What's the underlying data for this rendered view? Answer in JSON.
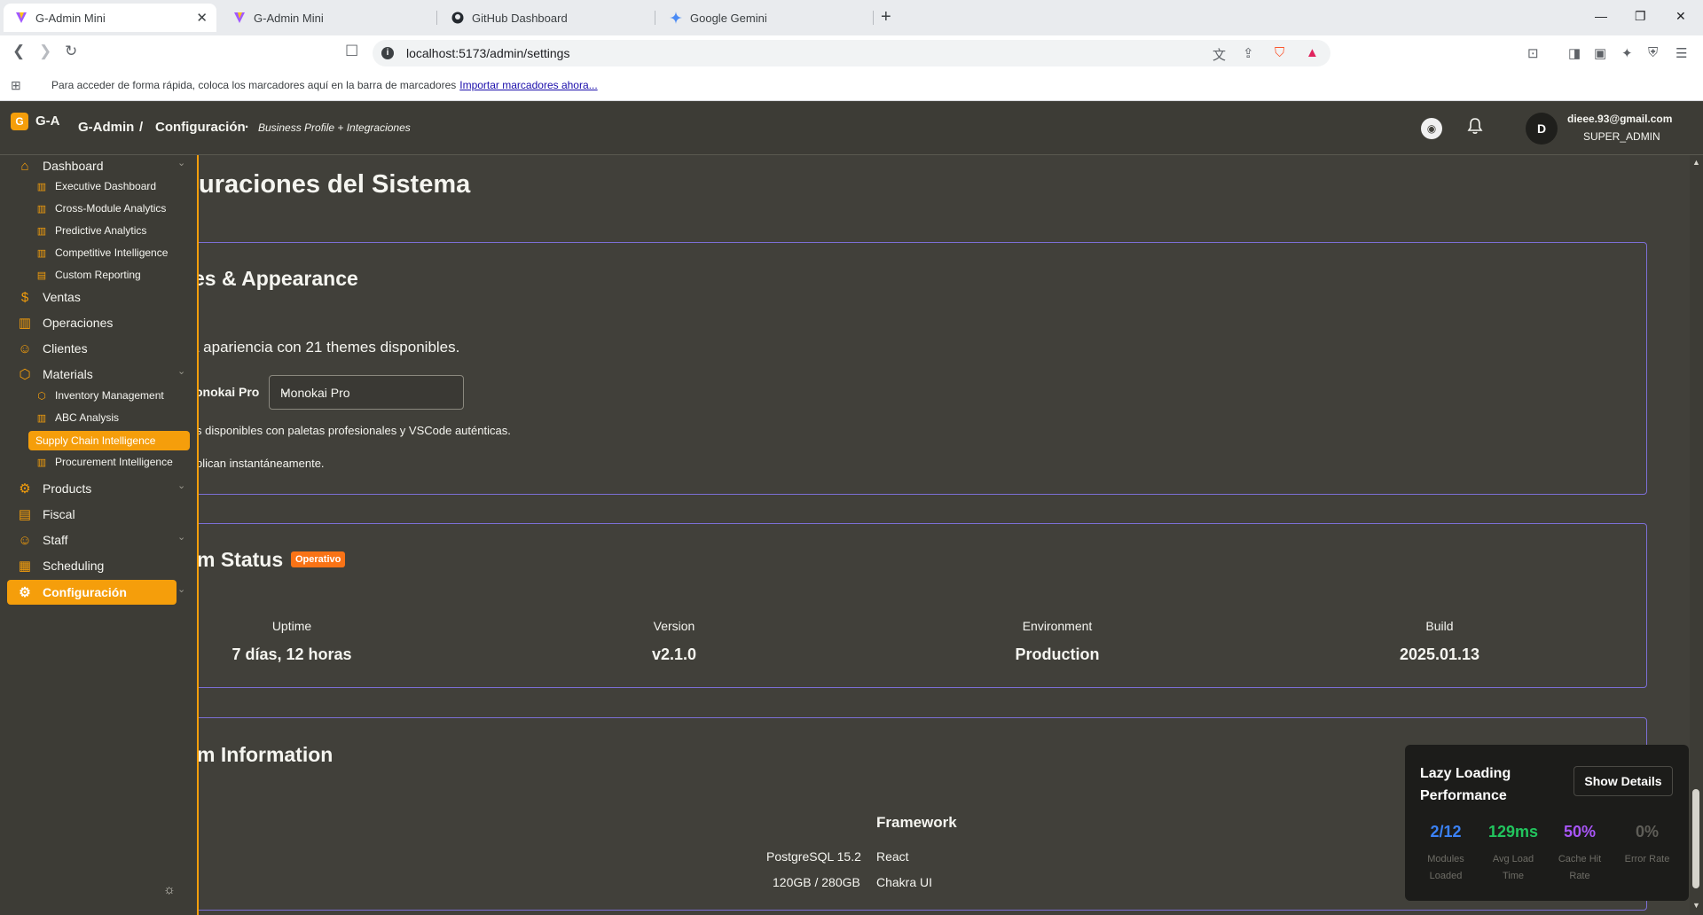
{
  "browser": {
    "tabs": [
      {
        "title": "G-Admin Mini",
        "icon": "vite-icon",
        "active": true
      },
      {
        "title": "G-Admin Mini",
        "icon": "vite-icon",
        "active": false
      },
      {
        "title": "GitHub Dashboard",
        "icon": "github-icon",
        "active": false
      },
      {
        "title": "Google Gemini",
        "icon": "gemini-icon",
        "active": false
      }
    ],
    "url": "localhost:5173/admin/settings",
    "bookmarks_message": "Para acceder de forma rápida, coloca los marcadores aquí en la barra de marcadores",
    "bookmarks_link": "Importar marcadores ahora..."
  },
  "header": {
    "brand_badge": "G",
    "brand": "G-A",
    "crumb_root": "G-Admin",
    "crumb_sep": "/",
    "crumb_current": "Configuración",
    "crumb_dot": "·",
    "crumb_sub": "Business Profile + Integraciones",
    "user": {
      "initial": "D",
      "email": "dieee.93@gmail.com",
      "role": "SUPER_ADMIN"
    }
  },
  "sidebar": {
    "items": [
      {
        "label": "Dashboard",
        "icon": "home-icon"
      },
      {
        "label": "Executive Dashboard",
        "icon": "bar-chart-icon"
      },
      {
        "label": "Cross-Module Analytics",
        "icon": "bar-chart-icon"
      },
      {
        "label": "Predictive Analytics",
        "icon": "bar-chart-icon"
      },
      {
        "label": "Competitive Intelligence",
        "icon": "bar-chart-icon"
      },
      {
        "label": "Custom Reporting",
        "icon": "file-icon"
      },
      {
        "label": "Ventas",
        "icon": "dollar-icon"
      },
      {
        "label": "Operaciones",
        "icon": "bar-chart-icon"
      },
      {
        "label": "Clientes",
        "icon": "users-icon"
      },
      {
        "label": "Materials",
        "icon": "cube-icon"
      },
      {
        "label": "Inventory Management",
        "icon": "cube-icon"
      },
      {
        "label": "ABC Analysis",
        "icon": "bar-chart-icon"
      },
      {
        "label": "Supply Chain Intelligence",
        "icon": "bar-chart-icon"
      },
      {
        "label": "Procurement Intelligence",
        "icon": "bar-chart-icon"
      },
      {
        "label": "Products",
        "icon": "gear-icon"
      },
      {
        "label": "Fiscal",
        "icon": "document-icon"
      },
      {
        "label": "Staff",
        "icon": "users-icon"
      },
      {
        "label": "Scheduling",
        "icon": "calendar-icon"
      },
      {
        "label": "Configuración",
        "icon": "gear-icon"
      }
    ]
  },
  "main": {
    "page_title": "uraciones del Sistema",
    "themes": {
      "title": "es & Appearance",
      "description": "a apariencia con 21 themes disponibles.",
      "select_label": "onokai Pro",
      "select_value": "Monokai Pro",
      "note1": "s disponibles con paletas profesionales y VSCode auténticas.",
      "note2": "plican instantáneamente."
    },
    "status": {
      "title": "m Status",
      "badge": "Operativo",
      "stats": [
        {
          "label": "Uptime",
          "value": "7 días, 12 horas"
        },
        {
          "label": "Version",
          "value": "v2.1.0"
        },
        {
          "label": "Environment",
          "value": "Production"
        },
        {
          "label": "Build",
          "value": "2025.01.13"
        }
      ]
    },
    "info": {
      "title": "m Information",
      "framework_heading": "Framework",
      "left_values": [
        "PostgreSQL 15.2",
        "120GB / 280GB"
      ],
      "framework_values": [
        "React",
        "Chakra UI"
      ]
    }
  },
  "perf": {
    "title": "Lazy Loading Performance",
    "button": "Show Details",
    "metrics": [
      {
        "value": "2/12",
        "label": "Modules Loaded",
        "color": "#3b82f6"
      },
      {
        "value": "129ms",
        "label": "Avg Load Time",
        "color": "#22c55e"
      },
      {
        "value": "50%",
        "label": "Cache Hit Rate",
        "color": "#a855f7"
      },
      {
        "value": "0%",
        "label": "Error Rate",
        "color": "#5f5e58"
      }
    ]
  },
  "colors": {
    "accent": "#f59e0b",
    "card_border": "#7c6fd6",
    "badge": "#f97316"
  }
}
